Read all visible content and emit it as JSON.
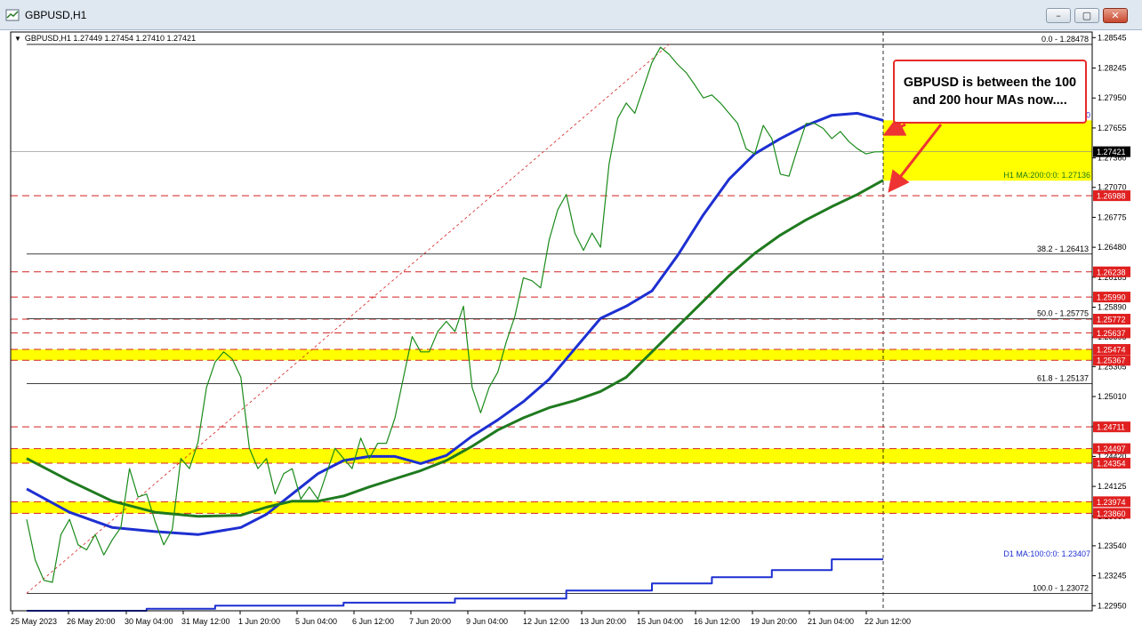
{
  "window": {
    "title": "GBPUSD,H1",
    "buttons": [
      "–",
      "▢",
      "✕"
    ]
  },
  "chart_header": "GBPUSD,H1  1.27449 1.27454 1.27410 1.27421",
  "annotation": {
    "line1": "GBPUSD is between the 100",
    "line2": "and 200 hour MAs now...."
  },
  "colors": {
    "ma100": "#1d2fd1",
    "ma200": "#1f7a1f",
    "zone": "#ffff00",
    "level_line": "#d42020",
    "fib": "#000000",
    "candle": "#1a8a1a",
    "arrow": "#ee3333"
  },
  "chart_data": {
    "type": "line",
    "symbol": "GBPUSD",
    "timeframe": "H1",
    "ohlc_last": {
      "open": 1.27449,
      "high": 1.27454,
      "low": 1.2741,
      "close": 1.27421
    },
    "current_price": "1.27421",
    "ylim": [
      1.229,
      1.286
    ],
    "y_ticks": [
      "1.28545",
      "1.28245",
      "1.27950",
      "1.27655",
      "1.27360",
      "1.27070",
      "1.26775",
      "1.26480",
      "1.26185",
      "1.25890",
      "1.25595",
      "1.25305",
      "1.25010",
      "1.24715",
      "1.24420",
      "1.24125",
      "1.23830",
      "1.23540",
      "1.23245",
      "1.22950"
    ],
    "x_ticks": [
      "25 May 2023",
      "26 May 20:00",
      "30 May 04:00",
      "31 May 12:00",
      "1 Jun 20:00",
      "5 Jun 04:00",
      "6 Jun 12:00",
      "7 Jun 20:00",
      "9 Jun 04:00",
      "12 Jun 12:00",
      "13 Jun 20:00",
      "15 Jun 04:00",
      "16 Jun 12:00",
      "19 Jun 20:00",
      "21 Jun 04:00",
      "22 Jun 12:00"
    ],
    "fib_levels": [
      {
        "label": "0.0 - 1.28478",
        "price": 1.28478
      },
      {
        "label": "38.2 - 1.26413",
        "price": 1.26413
      },
      {
        "label": "50.0 - 1.25775",
        "price": 1.25775
      },
      {
        "label": "61.8 - 1.25137",
        "price": 1.25137
      },
      {
        "label": "100.0 - 1.23072",
        "price": 1.23072
      }
    ],
    "level_tags": [
      {
        "label": "1.26988",
        "price": 1.26988
      },
      {
        "label": "1.26238",
        "price": 1.26238
      },
      {
        "label": "1.25990",
        "price": 1.2599
      },
      {
        "label": "1.25772",
        "price": 1.25772
      },
      {
        "label": "1.25637",
        "price": 1.25637
      },
      {
        "label": "1.25474",
        "price": 1.25474
      },
      {
        "label": "1.25367",
        "price": 1.25367
      },
      {
        "label": "1.24711",
        "price": 1.24711
      },
      {
        "label": "1.24497",
        "price": 1.24497
      },
      {
        "label": "1.24354",
        "price": 1.24354
      },
      {
        "label": "1.23974",
        "price": 1.23974
      },
      {
        "label": "1.23860",
        "price": 1.2386
      }
    ],
    "zones": [
      {
        "from": 1.25367,
        "to": 1.25474
      },
      {
        "from": 1.24354,
        "to": 1.24497
      },
      {
        "from": 1.2386,
        "to": 1.23974
      },
      {
        "from": 1.27136,
        "to": 1.2773
      }
    ],
    "ma_labels": [
      {
        "label": "H1 MA:100:0:0: 1.27730",
        "price": 1.2773,
        "color": "#1d2fd1"
      },
      {
        "label": "H1 MA:200:0:0: 1.27136",
        "price": 1.27136,
        "color": "#1f7a1f"
      },
      {
        "label": "D1 MA:100:0:0: 1.23407",
        "price": 1.23407,
        "color": "#1d2fd1"
      }
    ],
    "series": [
      {
        "name": "H1 MA 100",
        "color": "#1d2fd1",
        "x": [
          0,
          5,
          10,
          15,
          20,
          25,
          28,
          31,
          34,
          37,
          40,
          43,
          46,
          49,
          52,
          55,
          58,
          61,
          64,
          67,
          70,
          73,
          76,
          79,
          82,
          85,
          88,
          91,
          94,
          97,
          100
        ],
        "y": [
          1.241,
          1.2387,
          1.2372,
          1.2368,
          1.2365,
          1.2372,
          1.2385,
          1.2405,
          1.2425,
          1.2438,
          1.2442,
          1.2442,
          1.2435,
          1.2443,
          1.2462,
          1.2478,
          1.2496,
          1.2518,
          1.2548,
          1.2578,
          1.259,
          1.2605,
          1.264,
          1.268,
          1.2715,
          1.274,
          1.2755,
          1.2768,
          1.2778,
          1.278,
          1.2773
        ]
      },
      {
        "name": "H1 MA 200",
        "color": "#1f7a1f",
        "x": [
          0,
          5,
          10,
          15,
          20,
          25,
          28,
          31,
          34,
          37,
          40,
          43,
          46,
          49,
          52,
          55,
          58,
          61,
          64,
          67,
          70,
          73,
          76,
          79,
          82,
          85,
          88,
          91,
          94,
          97,
          100
        ],
        "y": [
          1.244,
          1.2418,
          1.2398,
          1.2387,
          1.2383,
          1.2384,
          1.2392,
          1.2398,
          1.2398,
          1.2403,
          1.2412,
          1.242,
          1.2428,
          1.2438,
          1.2452,
          1.2468,
          1.248,
          1.249,
          1.2497,
          1.2506,
          1.252,
          1.2545,
          1.257,
          1.2595,
          1.262,
          1.2642,
          1.266,
          1.2675,
          1.2688,
          1.27,
          1.2714
        ]
      },
      {
        "name": "D1 MA 100",
        "color": "#1d2fd1",
        "x": [
          0,
          14,
          14,
          22,
          22,
          37,
          37,
          50,
          50,
          63,
          63,
          73,
          73,
          80,
          80,
          87,
          87,
          94,
          94,
          100
        ],
        "y": [
          1.229,
          1.229,
          1.2292,
          1.2292,
          1.2295,
          1.2295,
          1.2298,
          1.2298,
          1.2302,
          1.2302,
          1.231,
          1.231,
          1.2317,
          1.2317,
          1.2323,
          1.2323,
          1.233,
          1.233,
          1.23407,
          1.23407
        ]
      },
      {
        "name": "Price",
        "color": "#1a8a1a",
        "x": [
          0,
          1,
          2,
          3,
          4,
          5,
          6,
          7,
          8,
          9,
          10,
          11,
          12,
          13,
          14,
          15,
          16,
          17,
          18,
          19,
          20,
          21,
          22,
          23,
          24,
          25,
          26,
          27,
          28,
          29,
          30,
          31,
          32,
          33,
          34,
          35,
          36,
          37,
          38,
          39,
          40,
          41,
          42,
          43,
          44,
          45,
          46,
          47,
          48,
          49,
          50,
          51,
          52,
          53,
          54,
          55,
          56,
          57,
          58,
          59,
          60,
          61,
          62,
          63,
          64,
          65,
          66,
          67,
          68,
          69,
          70,
          71,
          72,
          73,
          74,
          75,
          76,
          77,
          78,
          79,
          80,
          81,
          82,
          83,
          84,
          85,
          86,
          87,
          88,
          89,
          90,
          91,
          92,
          93,
          94,
          95,
          96,
          97,
          98,
          99,
          100
        ],
        "y": [
          1.238,
          1.234,
          1.232,
          1.2318,
          1.2365,
          1.238,
          1.2355,
          1.235,
          1.2365,
          1.2345,
          1.236,
          1.2372,
          1.243,
          1.2402,
          1.2405,
          1.2378,
          1.2355,
          1.237,
          1.244,
          1.243,
          1.2456,
          1.251,
          1.2535,
          1.2545,
          1.2538,
          1.252,
          1.245,
          1.243,
          1.244,
          1.2405,
          1.2425,
          1.243,
          1.24,
          1.2412,
          1.24,
          1.2425,
          1.245,
          1.244,
          1.243,
          1.246,
          1.244,
          1.2455,
          1.2455,
          1.248,
          1.252,
          1.256,
          1.2545,
          1.2545,
          1.2565,
          1.2575,
          1.2565,
          1.259,
          1.251,
          1.2485,
          1.251,
          1.2525,
          1.2555,
          1.258,
          1.2618,
          1.2615,
          1.2608,
          1.2655,
          1.2685,
          1.27,
          1.2662,
          1.2645,
          1.2662,
          1.2648,
          1.273,
          1.2775,
          1.279,
          1.278,
          1.2805,
          1.283,
          1.2845,
          1.2838,
          1.2828,
          1.282,
          1.2808,
          1.2795,
          1.2798,
          1.279,
          1.278,
          1.277,
          1.2745,
          1.274,
          1.2768,
          1.2755,
          1.272,
          1.2718,
          1.2745,
          1.277,
          1.277,
          1.2765,
          1.2755,
          1.2762,
          1.2752,
          1.2745,
          1.274,
          1.2742,
          1.27421
        ]
      }
    ],
    "fib_diagonal": {
      "from": {
        "x": 0,
        "y": 1.23072
      },
      "to": {
        "x": 75,
        "y": 1.28478
      }
    }
  }
}
